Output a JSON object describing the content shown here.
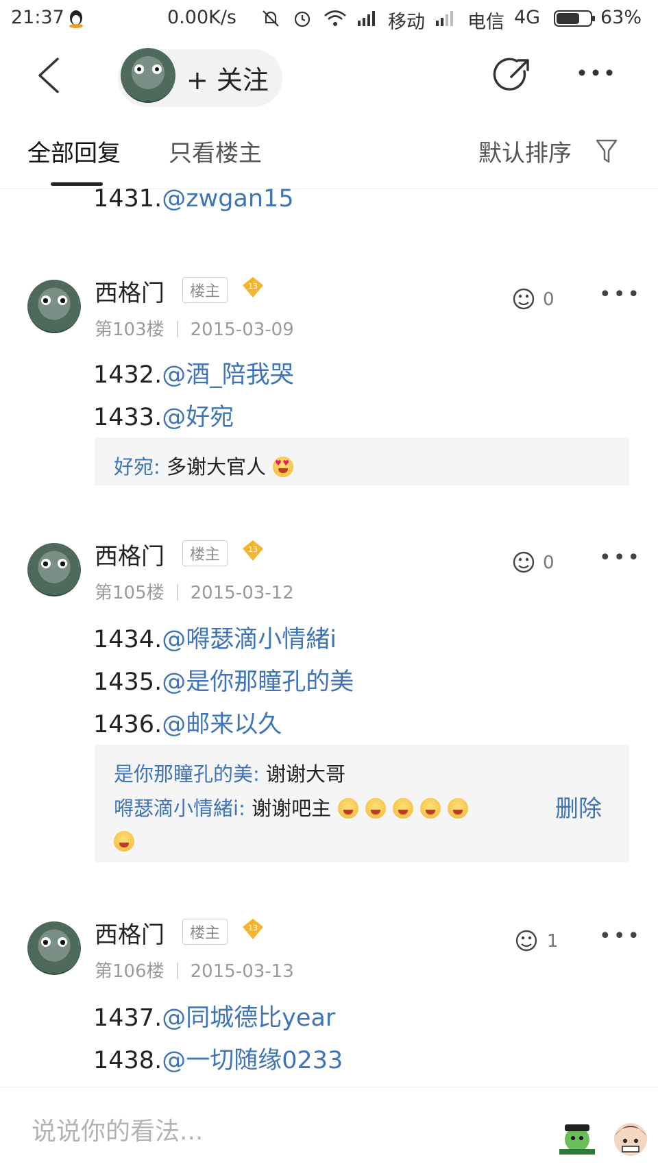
{
  "status_bar": {
    "time": "21:37",
    "speed": "0.00K/s",
    "carrier1": "移动",
    "carrier2": "电信",
    "network": "4G",
    "battery": "63%"
  },
  "nav": {
    "follow_label": "+ 关注"
  },
  "tabs": {
    "all_replies": "全部回复",
    "owner_only": "只看楼主",
    "sort": "默认排序"
  },
  "top_fragment": {
    "num": "1431.",
    "mention": "@zwgan15"
  },
  "posts": [
    {
      "author": "西格门",
      "tag": "楼主",
      "level": "13",
      "floor": "第103楼",
      "date": "2015-03-09",
      "likes": "0",
      "lines": [
        {
          "num": "1432.",
          "mention": "@酒_陪我哭"
        },
        {
          "num": "1433.",
          "mention": "@好宛"
        }
      ],
      "subreplies": [
        {
          "who": "好宛",
          "text": "多谢大官人"
        }
      ]
    },
    {
      "author": "西格门",
      "tag": "楼主",
      "level": "13",
      "floor": "第105楼",
      "date": "2015-03-12",
      "likes": "0",
      "lines": [
        {
          "num": "1434.",
          "mention": "@嘚瑟滴小情緒i"
        },
        {
          "num": "1435.",
          "mention": "@是你那瞳孔的美"
        },
        {
          "num": "1436.",
          "mention": "@邮来以久"
        }
      ],
      "subreplies": [
        {
          "who": "是你那瞳孔的美",
          "text": "谢谢大哥"
        },
        {
          "who": "嘚瑟滴小情緒i",
          "text": "谢谢吧主"
        }
      ],
      "delete_label": "删除"
    },
    {
      "author": "西格门",
      "tag": "楼主",
      "level": "13",
      "floor": "第106楼",
      "date": "2015-03-13",
      "likes": "1",
      "lines": [
        {
          "num": "1437.",
          "mention": "@同城德比year"
        },
        {
          "num": "1438.",
          "mention": "@一切随缘0233"
        }
      ]
    }
  ],
  "bottom": {
    "placeholder": "说说你的看法..."
  }
}
